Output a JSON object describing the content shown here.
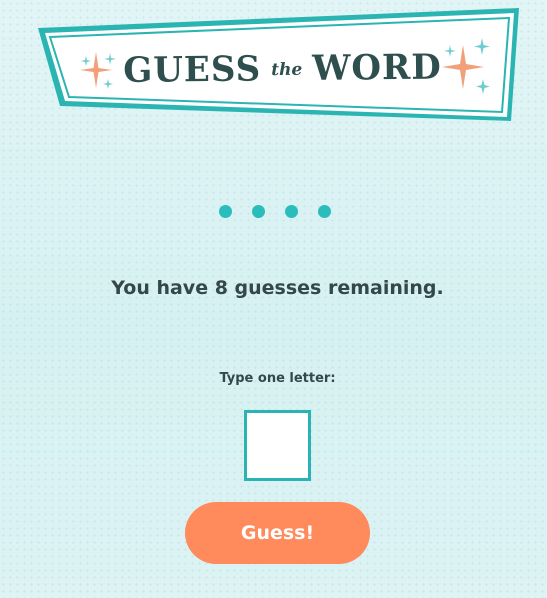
{
  "banner": {
    "title_part1": "GUESS",
    "title_part2": "the",
    "title_part3": "WORD",
    "frame_color": "#2bb5b2",
    "title_color": "#2f4f4f",
    "sparkle_colors": [
      "#f2a07b",
      "#6fcdd0"
    ]
  },
  "game": {
    "word_length": 4,
    "hidden_letter_marker_color": "#2bbcbc",
    "status_text": "You have 8 guesses remaining.",
    "guesses_remaining": 8
  },
  "input": {
    "label": "Type one letter:",
    "value": "",
    "border_color": "#2bb2b2"
  },
  "button": {
    "label": "Guess!",
    "color": "#ff8a5c"
  }
}
